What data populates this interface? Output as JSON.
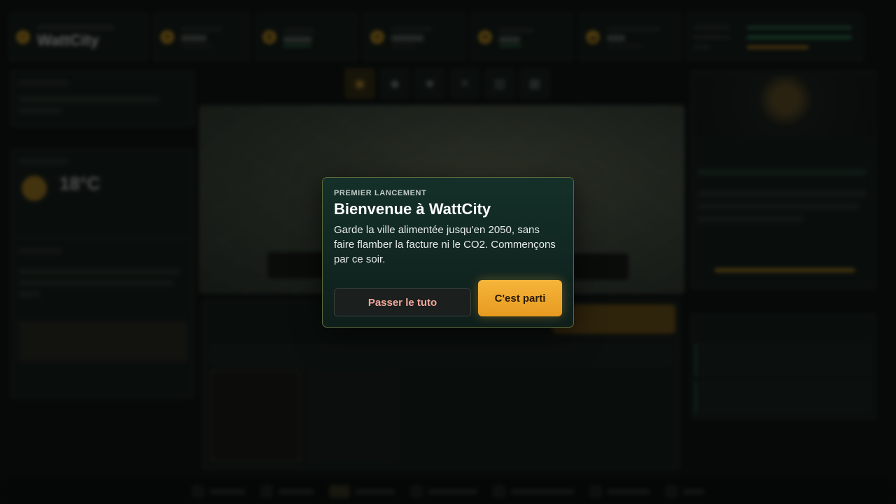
{
  "background": {
    "brand": "WattCity",
    "weather_temp": "18°C",
    "top_stats": [
      "",
      "",
      "",
      "",
      ""
    ],
    "tools": [
      "eye-icon",
      "pill-icon",
      "box-icon",
      "tools-icon",
      "panel-icon",
      "grid-icon"
    ]
  },
  "modal": {
    "kicker": "PREMIER LANCEMENT",
    "title": "Bienvenue à WattCity",
    "body": "Garde la ville alimentée jusqu'en 2050, sans faire flamber la facture ni le CO2. Commençons par ce soir.",
    "skip_label": "Passer le tuto",
    "start_label": "C'est parti"
  },
  "colors": {
    "accent": "#f0a92d",
    "modal_bg": "#12281f",
    "skip_text": "#f2a79b"
  }
}
